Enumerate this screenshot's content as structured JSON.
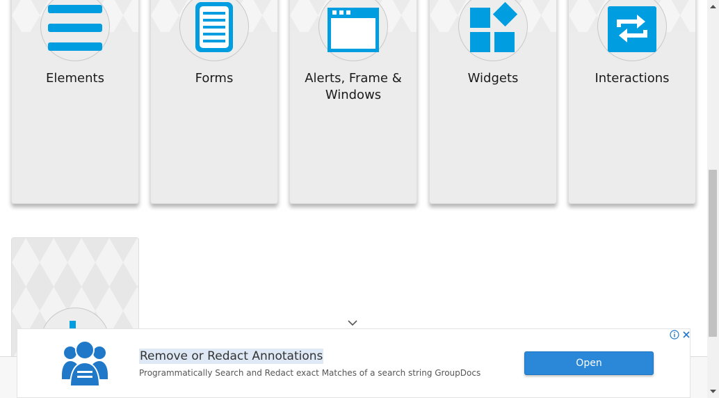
{
  "cards": [
    {
      "label": "Elements",
      "icon": "hamburger-menu-icon"
    },
    {
      "label": "Forms",
      "icon": "document-form-icon"
    },
    {
      "label": "Alerts, Frame & Windows",
      "icon": "browser-window-icon"
    },
    {
      "label": "Widgets",
      "icon": "widgets-icon"
    },
    {
      "label": "Interactions",
      "icon": "interactions-arrows-icon"
    }
  ],
  "partial_card": {
    "icon": "chart-bars-icon"
  },
  "ad": {
    "title": "Remove or Redact Annotations",
    "description": "Programmatically Search and Redact exact Matches of a search string GroupDocs",
    "open_label": "Open",
    "icon": "users-group-icon"
  },
  "colors": {
    "accent": "#009ee0",
    "card_bg": "#ececec",
    "ad_button": "#2b88d9"
  }
}
